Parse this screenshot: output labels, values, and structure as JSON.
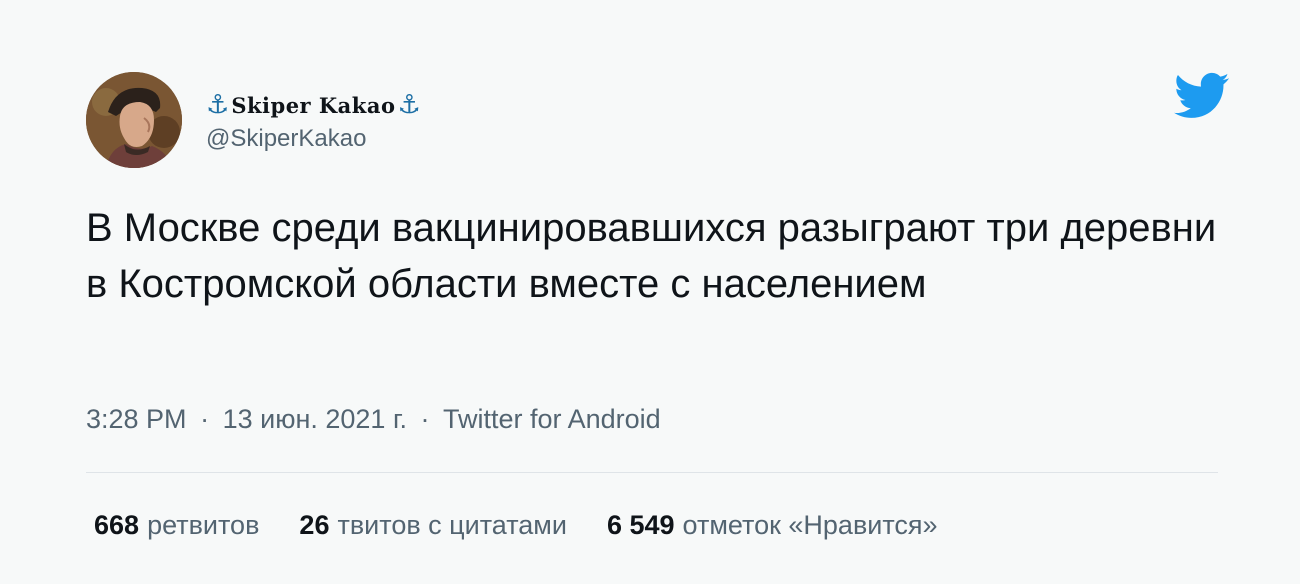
{
  "author": {
    "display_name": "Skiper Kakao",
    "anchor_symbol": "⚓",
    "handle": "@SkiperKakao",
    "avatar_icon": "portrait-avatar"
  },
  "tweet": {
    "text": "В Москве среди вакцинировавшихся разыграют три деревни в Костромской области вместе с населением"
  },
  "meta": {
    "time": "3:28 PM",
    "date": "13 июн. 2021 г.",
    "source": "Twitter for Android",
    "separator": "·"
  },
  "stats": [
    {
      "count": "668",
      "label": "ретвитов"
    },
    {
      "count": "26",
      "label": "твитов с цитатами"
    },
    {
      "count": "6 549",
      "label": "отметок «Нравится»"
    }
  ],
  "colors": {
    "background": "#f7f9f9",
    "text": "#0f1419",
    "secondary": "#536471",
    "twitter_blue": "#1d9bf0",
    "anchor": "#1d6fa5"
  },
  "icons": {
    "brand": "twitter-bird-icon",
    "name_decoration": "anchor-icon"
  }
}
